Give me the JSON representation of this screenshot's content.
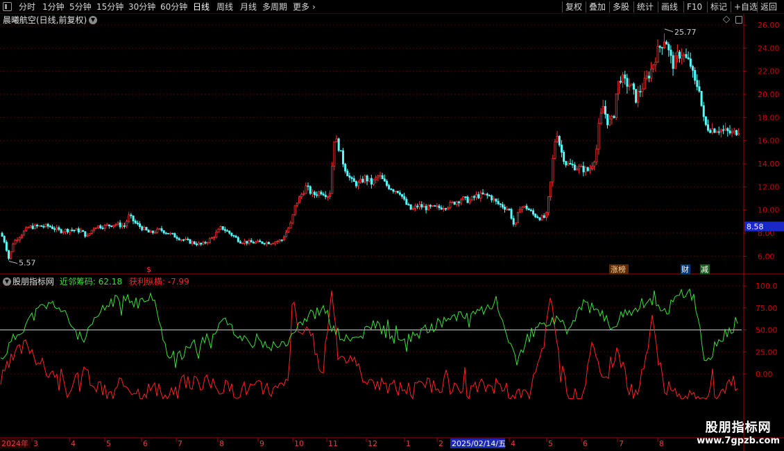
{
  "toolbar": {
    "periods": [
      "分时",
      "1分钟",
      "5分钟",
      "15分钟",
      "30分钟",
      "60分钟",
      "日线",
      "周线",
      "月线",
      "多周期",
      "更多"
    ],
    "active_period": "日线",
    "right_buttons": [
      "复权",
      "叠加",
      "多股",
      "统计",
      "画线",
      "F10",
      "标记",
      "+自选",
      "返回"
    ]
  },
  "main_chart": {
    "title": "晨曦航空(日线,前复权)",
    "price_ticks": [
      "26.00",
      "24.00",
      "22.00",
      "20.00",
      "18.00",
      "16.00",
      "14.00",
      "12.00",
      "10.00",
      "8.00",
      "6.00"
    ],
    "high_label": "25.77",
    "low_label": "5.57",
    "last_price": "8.58",
    "markers": {
      "dollar": "$",
      "zhangbang": "涨榜",
      "cai": "财",
      "jian": "减"
    },
    "colors": {
      "up": "#ff3232",
      "down": "#54fcfc",
      "grid": "#5a0000",
      "axis": "#aa0000",
      "price_tag": "#1a28c8"
    }
  },
  "indicator": {
    "name": "股朋指标网",
    "line1_label": "近邻筹码",
    "line1_value": "62.18",
    "line2_label": "获利纵横",
    "line2_value": "-7.99",
    "ticks": [
      "100.0",
      "75.00",
      "50.00",
      "25.00",
      "0.00"
    ],
    "colors": {
      "line1": "#3ce03c",
      "line2": "#ff2020",
      "level": "#e8e800"
    }
  },
  "time_axis": {
    "year": "2024年",
    "months": [
      "3",
      "4",
      "5",
      "6",
      "7",
      "8",
      "9",
      "10",
      "11",
      "12",
      "1",
      "2",
      "4",
      "5",
      "6",
      "7",
      "8"
    ],
    "cursor_date": "2025/02/14/五"
  },
  "watermark": {
    "title": "股朋指标网",
    "url": "www.7gpzb.com"
  },
  "chart_data": {
    "type": "candlestick",
    "title": "晨曦航空(日线,前复权)",
    "ylim": [
      5,
      27
    ],
    "period_high": 25.77,
    "period_low": 5.57,
    "last_price": 8.58,
    "x_months": [
      "2024-03",
      "2024-04",
      "2024-05",
      "2024-06",
      "2024-07",
      "2024-08",
      "2024-09",
      "2024-10",
      "2024-11",
      "2024-12",
      "2025-01",
      "2025-02",
      "2025-04",
      "2025-05",
      "2025-06",
      "2025-07",
      "2025-08"
    ],
    "close_approx": [
      {
        "x": "2024-03",
        "y": 7.6
      },
      {
        "x": "2024-04",
        "y": 8.6
      },
      {
        "x": "2024-05",
        "y": 8.7
      },
      {
        "x": "2024-06",
        "y": 8.9
      },
      {
        "x": "2024-07",
        "y": 7.5
      },
      {
        "x": "2024-08",
        "y": 7.8
      },
      {
        "x": "2024-09",
        "y": 7.1
      },
      {
        "x": "2024-10",
        "y": 11.0
      },
      {
        "x": "2024-11",
        "y": 13.5
      },
      {
        "x": "2024-12",
        "y": 12.5
      },
      {
        "x": "2025-01",
        "y": 10.4
      },
      {
        "x": "2025-02",
        "y": 10.6
      },
      {
        "x": "2025-04",
        "y": 9.6
      },
      {
        "x": "2025-05",
        "y": 14.2
      },
      {
        "x": "2025-06",
        "y": 18.5
      },
      {
        "x": "2025-07",
        "y": 21.5
      },
      {
        "x": "2025-08",
        "y": 17.0
      }
    ],
    "indicator_series": [
      {
        "name": "近邻筹码",
        "last": 62.18
      },
      {
        "name": "获利纵横",
        "last": -7.99
      }
    ],
    "indicator_ylim": [
      -30,
      105
    ],
    "reference_level": 50
  }
}
